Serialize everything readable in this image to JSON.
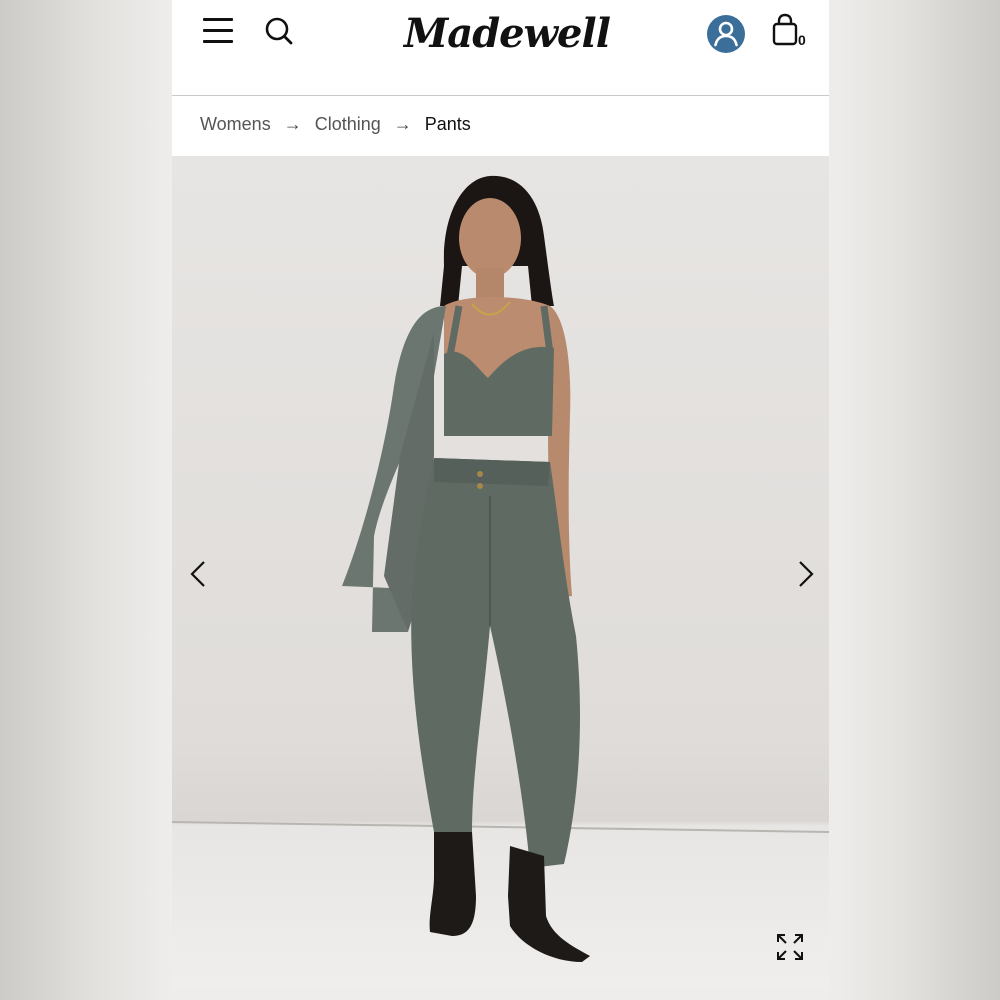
{
  "header": {
    "logo_text": "Madewell",
    "bag_count": "0",
    "icons": {
      "menu": "hamburger-menu-icon",
      "search": "search-icon",
      "account": "user-account-icon",
      "bag": "shopping-bag-icon"
    },
    "account_color": "#3b6e99"
  },
  "breadcrumb": {
    "items": [
      "Womens",
      "Clothing",
      "Pants"
    ],
    "separator": "→"
  },
  "product_gallery": {
    "image_description": "Model wearing a sage green cropped bralette top and high-rise pleated tapered pants with matching blazer over shoulder and black ankle boots",
    "icons": {
      "prev": "chevron-left-icon",
      "next": "chevron-right-icon",
      "expand": "expand-arrows-icon"
    },
    "garment_color": "#5f6a63"
  }
}
